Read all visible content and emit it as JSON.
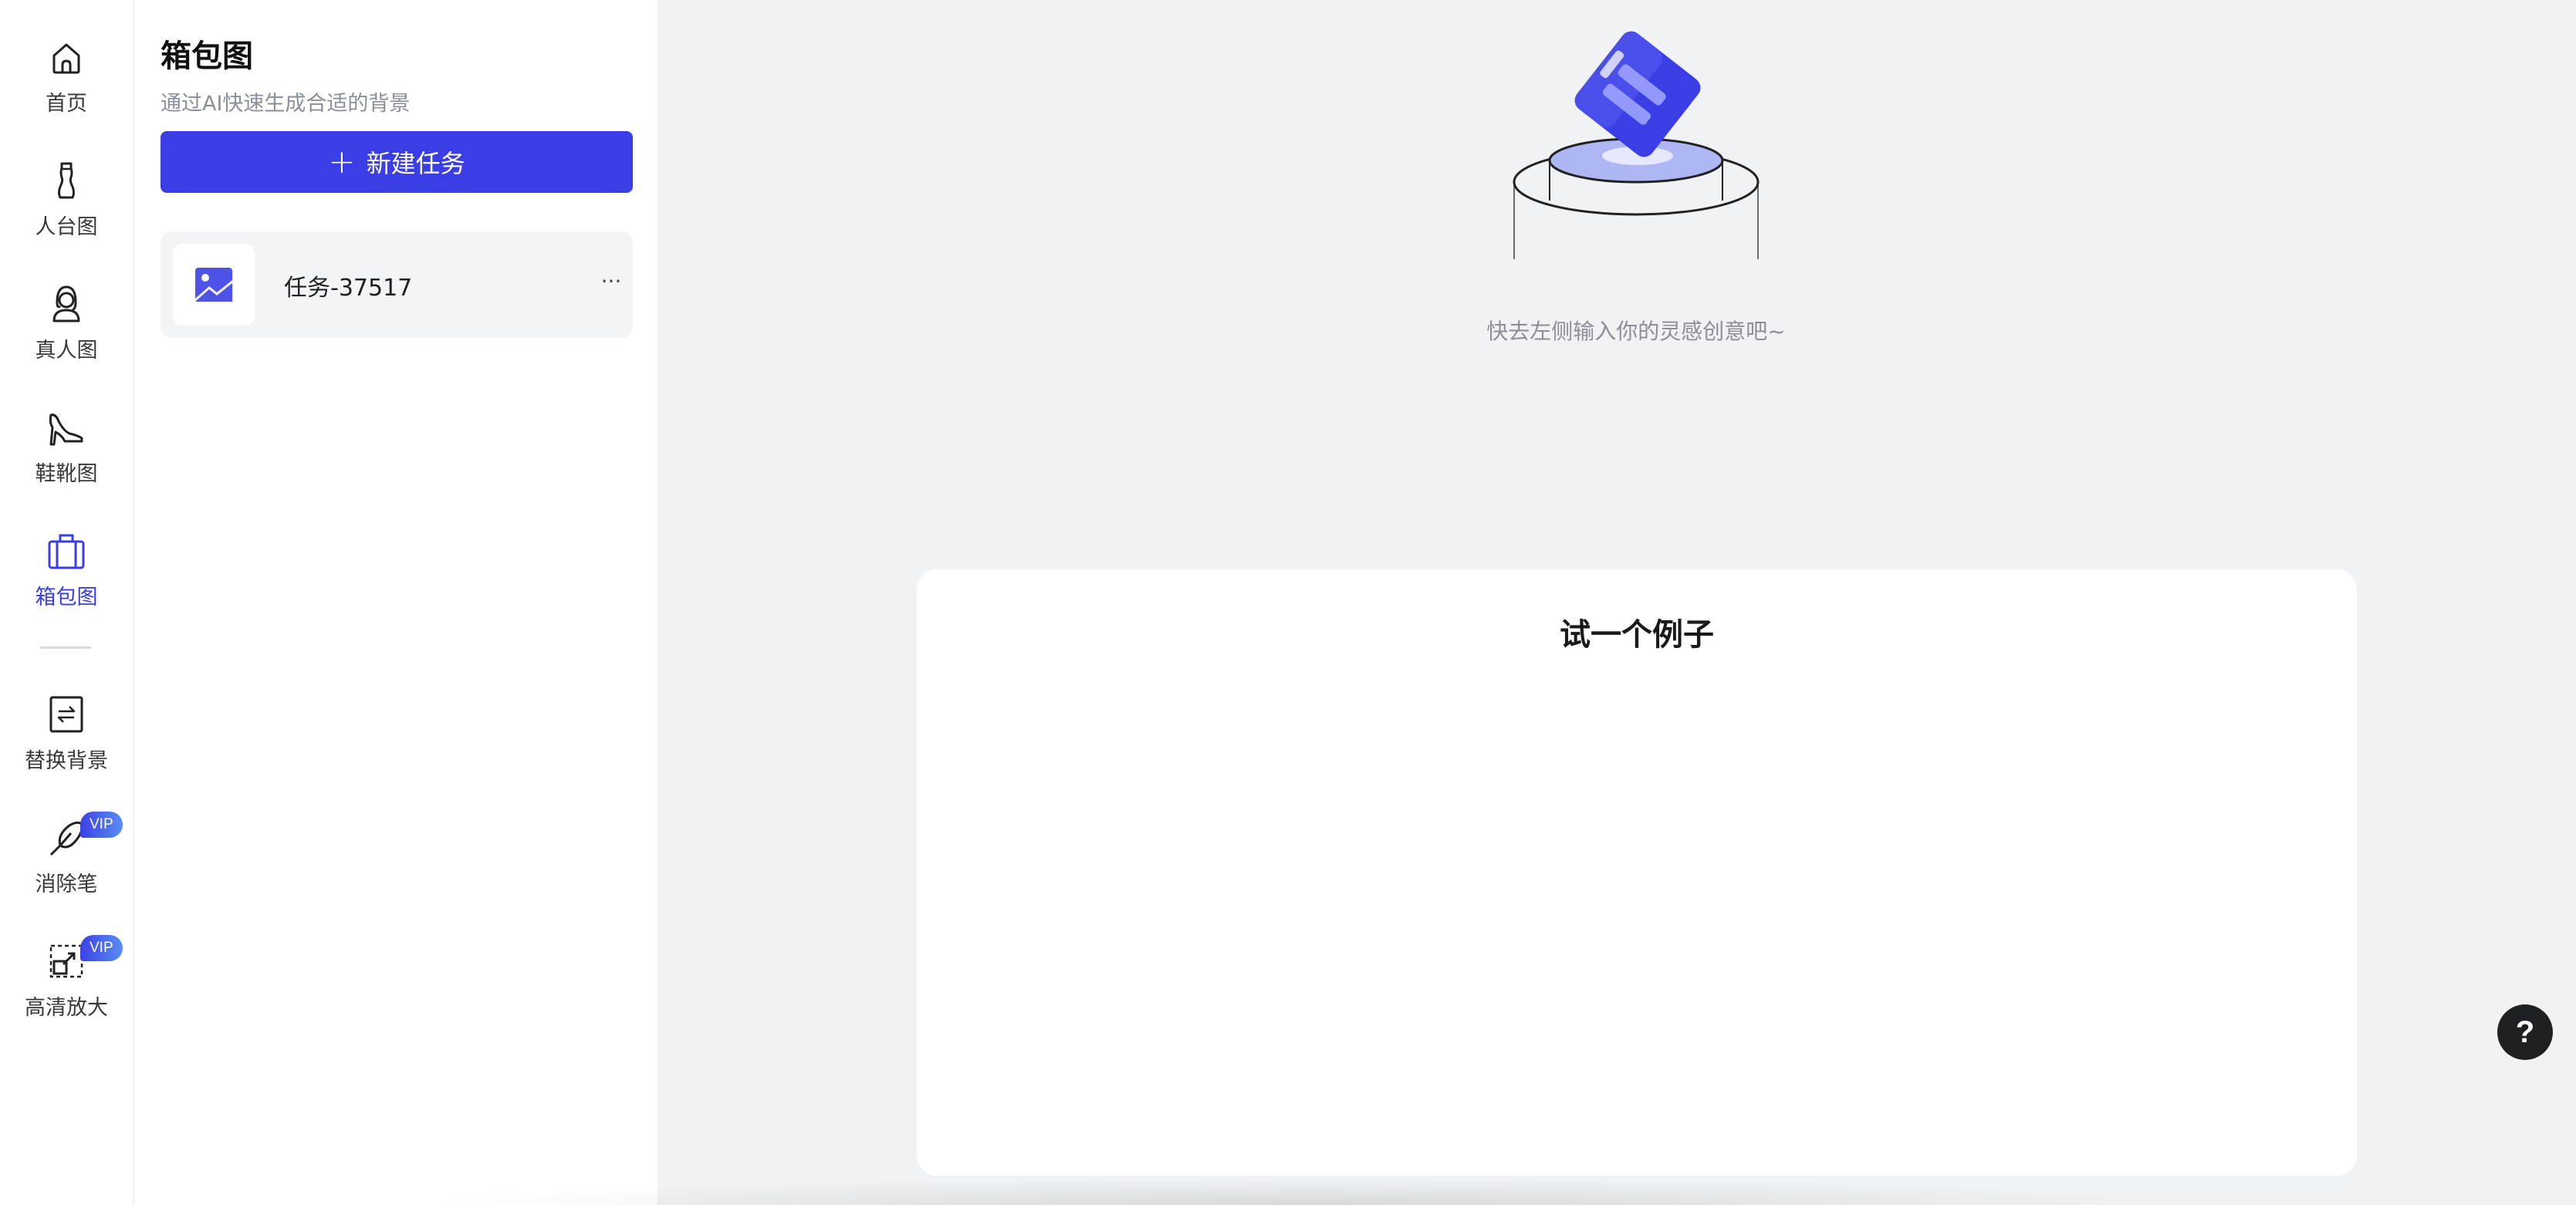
{
  "nav": {
    "items": [
      {
        "label": "首页",
        "icon": "home-icon"
      },
      {
        "label": "人台图",
        "icon": "mannequin-icon"
      },
      {
        "label": "真人图",
        "icon": "person-icon"
      },
      {
        "label": "鞋靴图",
        "icon": "high-heel-icon"
      },
      {
        "label": "箱包图",
        "icon": "bag-icon",
        "active": true
      },
      {
        "label": "替换背景",
        "icon": "swap-background-icon"
      },
      {
        "label": "消除笔",
        "icon": "eraser-pen-icon",
        "badge": "VIP"
      },
      {
        "label": "高清放大",
        "icon": "upscale-icon",
        "badge": "VIP"
      }
    ]
  },
  "panel": {
    "title": "箱包图",
    "subtitle": "通过AI快速生成合适的背景",
    "new_task_label": "新建任务",
    "new_task_icon": "plus-icon",
    "tasks": [
      {
        "name": "任务-37517",
        "thumb_icon": "image-icon",
        "more_label": "···"
      }
    ]
  },
  "main": {
    "empty_hint": "快去左侧输入你的灵感创意吧~",
    "example_title": "试一个例子"
  },
  "help": {
    "label": "?"
  },
  "colors": {
    "accent": "#3b3ee4",
    "background": "#f1f2f4",
    "panel": "#ffffff",
    "help_button": "#1f2024"
  }
}
